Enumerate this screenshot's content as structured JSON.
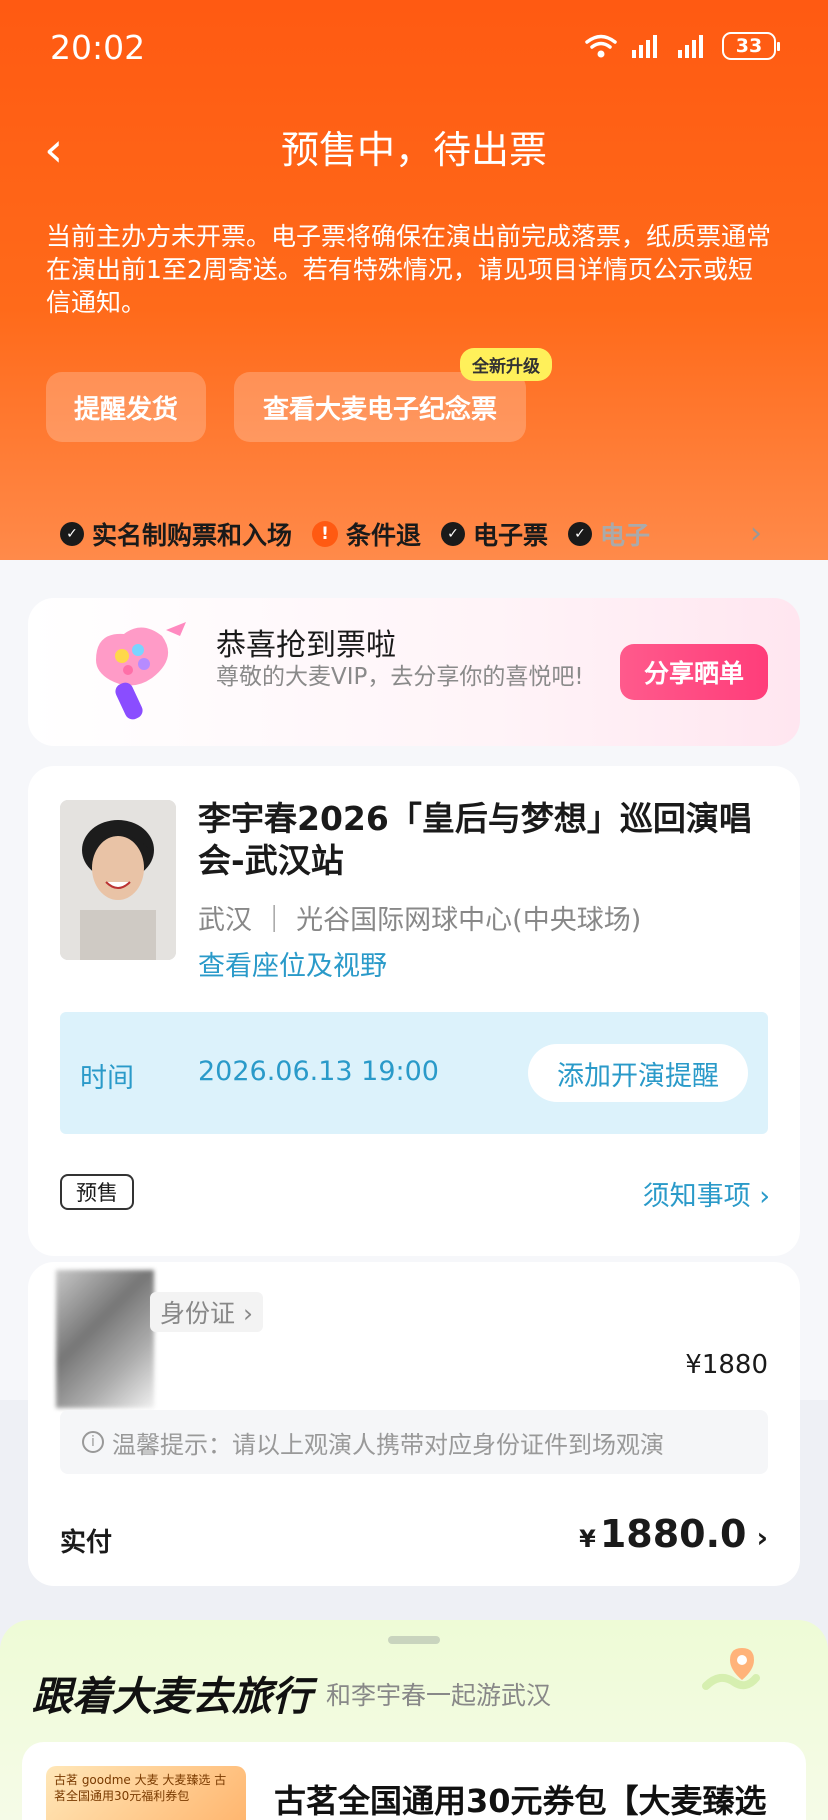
{
  "status_bar": {
    "time": "20:02",
    "battery": "33"
  },
  "nav": {
    "title": "预售中，待出票"
  },
  "notice": "当前主办方未开票。电子票将确保在演出前完成落票，纸质票通常在演出前1至2周寄送。若有特殊情况，请见项目详情页公示或短信通知。",
  "actions": {
    "remind_label": "提醒发货",
    "ticket_label": "查看大麦电子纪念票",
    "new_badge": "全新升级"
  },
  "tags": [
    "实名制购票和入场",
    "条件退",
    "电子票",
    "电子"
  ],
  "congrats": {
    "title": "恭喜抢到票啦",
    "subtitle": "尊敬的大麦VIP，去分享你的喜悦吧!",
    "button": "分享晒单"
  },
  "show": {
    "title": "李宇春2026「皇后与梦想」巡回演唱会-武汉站",
    "venue": "武汉 ｜ 光谷国际网球中心(中央球场)",
    "seat_link": "查看座位及视野",
    "time_label": "时间",
    "time_value": "2026.06.13 19:00",
    "remind_button": "添加开演提醒",
    "presale_tag": "预售",
    "notes_link": "须知事项"
  },
  "ticket": {
    "id_label": "身份证",
    "price": "¥1880",
    "tip": "温馨提示：请以上观演人携带对应身份证件到场观演",
    "paid_label": "实付",
    "paid_currency": "¥",
    "paid_value": "1880.0"
  },
  "travel": {
    "title": "跟着大麦去旅行",
    "subtitle": "和李宇春一起游武汉",
    "goods_title": "古茗全国通用30元券包【大麦臻选",
    "goods_thumb_text": "古茗 goodme 大麦 大麦臻选 古茗全国通用30元福利券包"
  },
  "colors": {
    "brand_orange": "#ff5a12",
    "link_blue": "#2a9ac9",
    "share_pink": "#ff3d7a"
  }
}
